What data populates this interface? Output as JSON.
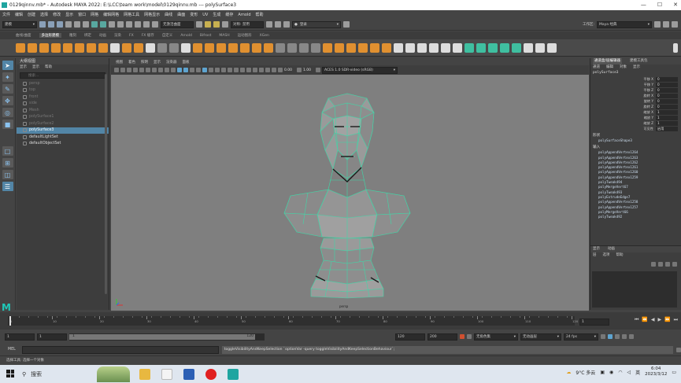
{
  "window": {
    "title": "0129qinnv.mb* - Autodesk MAYA 2022: E:\\LCC\\team work\\model\\0129qinnv.mb  ---  polySurface3"
  },
  "menu": [
    "文件",
    "编辑",
    "创建",
    "选择",
    "修改",
    "显示",
    "窗口",
    "网格",
    "编辑网格",
    "网格工具",
    "网格显示",
    "曲线",
    "曲面",
    "变形",
    "UV",
    "生成",
    "缓存",
    "Arnold",
    "帮助"
  ],
  "status": {
    "menu_set": "建模",
    "symmetry": "对称: 禁用",
    "live_surface": "无激活曲面",
    "login": "登录",
    "workspace_label": "工作区:",
    "workspace": "Maya 经典"
  },
  "shelf_tabs": [
    "曲线/曲面",
    "多边形建模",
    "雕刻",
    "绑定",
    "动画",
    "渲染",
    "FX",
    "FX 缓存",
    "自定义",
    "Arnold",
    "Bifrost",
    "MASH",
    "运动图形",
    "XGen"
  ],
  "shelf_active": "多边形建模",
  "outliner": {
    "title": "大纲视图",
    "menu": [
      "显示",
      "显示",
      "帮助"
    ],
    "search_placeholder": "搜索...",
    "items": [
      {
        "label": "persp",
        "state": "hidden"
      },
      {
        "label": "top",
        "state": "hidden"
      },
      {
        "label": "front",
        "state": "hidden"
      },
      {
        "label": "side",
        "state": "hidden"
      },
      {
        "label": "Mesh",
        "state": "hidden"
      },
      {
        "label": "polySurface1",
        "state": "hidden"
      },
      {
        "label": "polySurface2",
        "state": "hidden"
      },
      {
        "label": "polySurface3",
        "state": "selected"
      },
      {
        "label": "defaultLightSet",
        "state": "visible"
      },
      {
        "label": "defaultObjectSet",
        "state": "visible"
      }
    ]
  },
  "viewport": {
    "menu": [
      "视图",
      "着色",
      "照明",
      "显示",
      "渲染器",
      "面板"
    ],
    "field_a": "0.00",
    "field_b": "1.00",
    "color_space": "ACES 1.0 SDR-video (sRGB)",
    "camera_label": "persp"
  },
  "channel_box": {
    "tabs": [
      "通道盒/层编辑器",
      "建模工具包"
    ],
    "menu": [
      "通道",
      "编辑",
      "对象",
      "显示"
    ],
    "object": "polySurface3",
    "channels": [
      {
        "name": "平移 X",
        "value": "0"
      },
      {
        "name": "平移 Y",
        "value": "0"
      },
      {
        "name": "平移 Z",
        "value": "0"
      },
      {
        "name": "旋转 X",
        "value": "0"
      },
      {
        "name": "旋转 Y",
        "value": "0"
      },
      {
        "name": "旋转 Z",
        "value": "0"
      },
      {
        "name": "缩放 X",
        "value": "1"
      },
      {
        "name": "缩放 Y",
        "value": "1"
      },
      {
        "name": "缩放 Z",
        "value": "1"
      },
      {
        "name": "可见性",
        "value": "启用"
      }
    ],
    "shapes_label": "形状",
    "shape": "polySurfaceShape3",
    "inputs_label": "输入",
    "inputs": [
      "polyAppendVertex1264",
      "polyAppendVertex1263",
      "polyAppendVertex1262",
      "polyAppendVertex1261",
      "polyAppendVertex1260",
      "polyAppendVertex1259",
      "polyTweak494",
      "polyMergeVert67",
      "polyTweak493",
      "polyExtrudeEdge7",
      "polyAppendVertex1258",
      "polyAppendVertex1257",
      "polyMergeVert66",
      "polyTweak492"
    ]
  },
  "layer_editor": {
    "tabs": [
      "显示",
      "动画"
    ],
    "menu": [
      "层",
      "选项",
      "帮助"
    ]
  },
  "timeline": {
    "ticks": [
      1,
      10,
      20,
      30,
      40,
      50,
      60,
      70,
      80,
      90,
      100,
      110,
      120
    ],
    "current_frame": "1"
  },
  "range": {
    "start": "1",
    "start_inner": "1",
    "slider_start": "1",
    "slider_end": "120",
    "end_inner": "120",
    "end": "200",
    "character_set": "无角色集",
    "anim_layer": "无动画层",
    "fps": "24 fps"
  },
  "command": {
    "label": "MEL",
    "output": "toggleVisibilityAndKeepSelection `optionVar -query toggleVisibilityAndKeepSelectionBehaviour`;"
  },
  "help_line": "选择工具: 选择一个对象",
  "taskbar": {
    "search": "搜索",
    "weather": "9°C 多云",
    "ime": "英",
    "time": "6:04",
    "date": "2023/3/12"
  },
  "colors": {
    "selection": "#5285a6",
    "wireframe": "#3fd8a8",
    "viewport_bg": "#7f7f7f"
  }
}
